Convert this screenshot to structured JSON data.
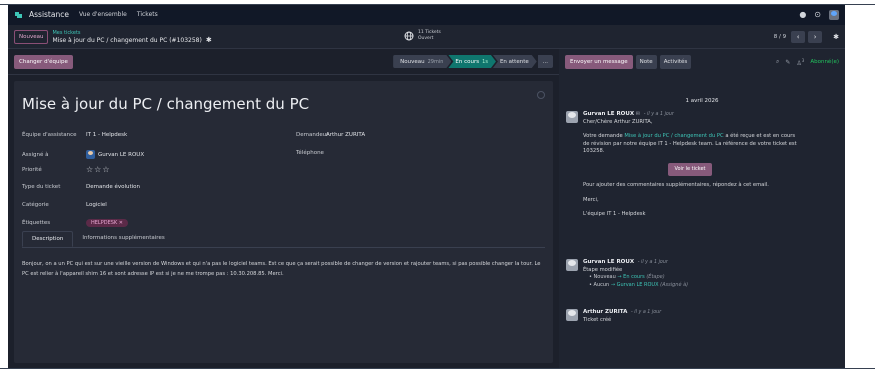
{
  "topnav": {
    "app_title": "Assistance",
    "menu": [
      "Vue d'ensemble",
      "Tickets"
    ]
  },
  "control": {
    "new_label": "Nouveau",
    "breadcrumb_parent": "Mes tickets",
    "breadcrumb_current": "Mise à jour du PC / changement du PC (#103258)",
    "stat_line1": "11 Tickets",
    "stat_line2": "Ouvert",
    "pager": "8 / 9"
  },
  "statusbar": {
    "change_team_label": "Changer d'équipe",
    "stages": [
      {
        "label": "Nouveau",
        "extra": "29min"
      },
      {
        "label": "En cours",
        "extra": "1s"
      },
      {
        "label": "En attente",
        "extra": ""
      }
    ],
    "more_label": "..."
  },
  "ticket": {
    "title": "Mise à jour du PC / changement du PC",
    "team_label": "Équipe d'assistance",
    "team_value": "IT 1 - Helpdesk",
    "assigned_label": "Assigné à",
    "assigned_value": "Gurvan LE ROUX",
    "priority_label": "Priorité",
    "priority_stars": "☆☆☆",
    "type_label": "Type du ticket",
    "type_value": "Demande évolution",
    "category_label": "Catégorie",
    "category_value": "Logiciel",
    "tags_label": "Étiquettes",
    "tag_value": "HELPDESK ✕",
    "requester_label": "Demandeur",
    "requester_value": "Arthur ZURITA",
    "phone_label": "Téléphone",
    "phone_value": ""
  },
  "tabs": [
    "Description",
    "Informations supplémentaires"
  ],
  "description": "Bonjour, on a un PC qui est sur une vieille version de Windows et qui n'a pas le logiciel teams. Est ce que ça serait possible de changer de version et rajouter teams, si pas possible changer la tour. Le PC est relier à l'appareil shim 16 et sont adresse IP est si je ne me trompe pas : 10.30.208.85. Merci.",
  "chatter": {
    "send_label": "Envoyer un message",
    "note_label": "Note",
    "activities_label": "Activités",
    "followers_count": "3",
    "subscribed_label": "Abonné(e)",
    "date": "1 avril 2026",
    "msg1": {
      "author": "Gurvan LE ROUX",
      "when": "- il y a 1 jour",
      "greeting": "Cher/Chère Arthur ZURITA,",
      "p1_before": "Votre demande",
      "p1_link": "Mise à jour du PC / changement du PC",
      "p1_after": "a été reçue et est en cours de révision par notre équipe IT 1 - Helpdesk team. La référence de votre ticket est 103258.",
      "button": "Voir le ticket",
      "p2": "Pour ajouter des commentaires supplémentaires, répondez à cet email.",
      "p3": "Merci,",
      "p4": "L'équipe IT 1 - Helpdesk"
    },
    "msg2": {
      "author": "Gurvan LE ROUX",
      "when": "- il y a 1 jour",
      "subtitle": "Étape modifiée",
      "t1_from": "Nouveau",
      "t1_to": "En cours",
      "t1_hint": "(Étape)",
      "t2_from": "Aucun",
      "t2_to": "Gurvan LE ROUX",
      "t2_hint": "(Assigné à)"
    },
    "msg3": {
      "author": "Arthur ZURITA",
      "when": "- il y a 1 jour",
      "subtitle": "Ticket créé"
    }
  },
  "colors": {
    "accent": "#875a7b",
    "active_stage": "#0f766e",
    "link": "#3ec6b7"
  }
}
